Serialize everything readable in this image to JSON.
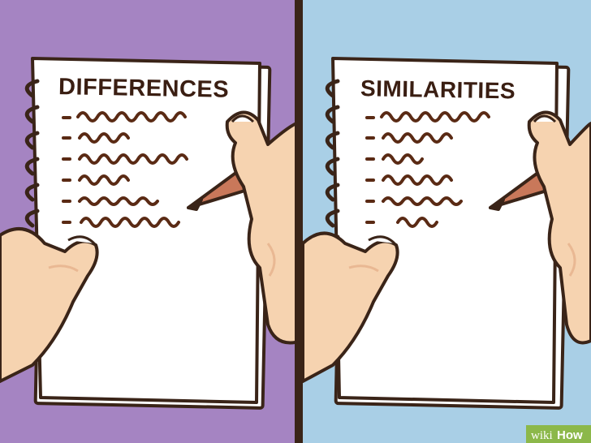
{
  "panels": {
    "left": {
      "title": "DIFFERENCES",
      "background": "#a584c2",
      "scribble_lines": 6
    },
    "right": {
      "title": "SIMILARITIES",
      "background": "#a9cfe6",
      "scribble_lines": 6
    }
  },
  "colors": {
    "divider": "#3a2418",
    "paper": "#ffffff",
    "paper_edge": "#3a2418",
    "ink": "#5a2a14",
    "skin": "#f6d3b0",
    "skin_shade": "#e9b893",
    "pencil": "#c9785a"
  },
  "watermark": {
    "prefix": "wiki",
    "suffix": "How",
    "badge_color": "#8cb84a"
  }
}
